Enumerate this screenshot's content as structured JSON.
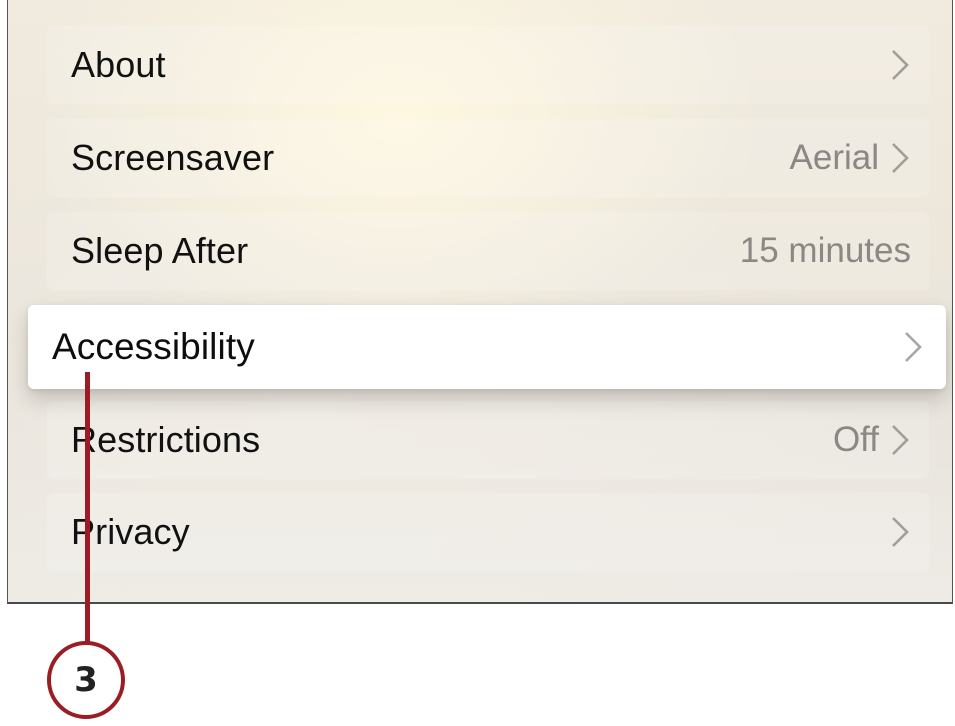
{
  "settings": {
    "items": [
      {
        "label": "About",
        "value": "",
        "chevron": true
      },
      {
        "label": "Screensaver",
        "value": "Aerial",
        "chevron": true
      },
      {
        "label": "Sleep After",
        "value": "15 minutes",
        "chevron": false
      },
      {
        "label": "Accessibility",
        "value": "",
        "chevron": true,
        "focused": true
      },
      {
        "label": "Restrictions",
        "value": "Off",
        "chevron": true
      },
      {
        "label": "Privacy",
        "value": "",
        "chevron": true
      }
    ]
  },
  "callout": {
    "number": "3",
    "color": "#9b1c24"
  },
  "colors": {
    "focused_row": "#ffffff",
    "label_text": "#111111",
    "value_text": "#8a8784"
  }
}
